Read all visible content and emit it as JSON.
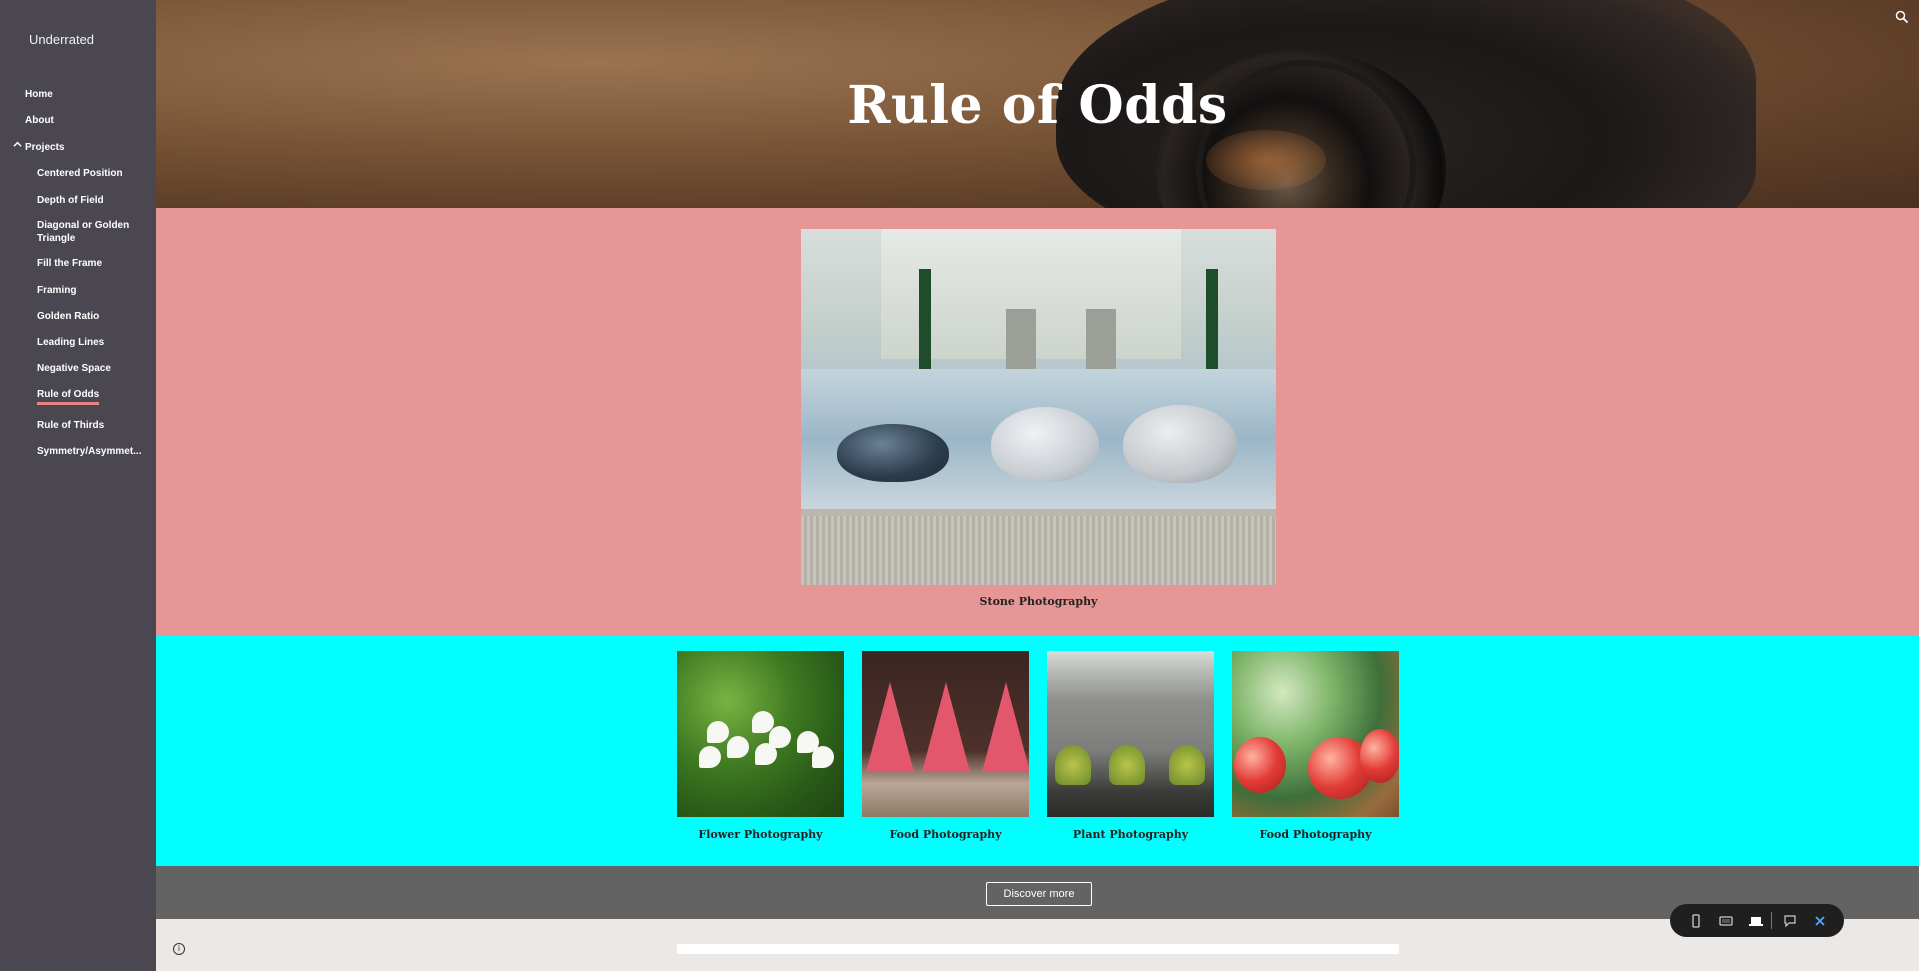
{
  "sidebar": {
    "site_title": "Underrated",
    "nav": {
      "home": "Home",
      "about": "About",
      "projects": "Projects",
      "sub": [
        "Centered Position",
        "Depth of Field",
        "Diagonal or Golden Triangle",
        "Fill the Frame",
        "Framing",
        "Golden Ratio",
        "Leading Lines",
        "Negative Space",
        "Rule of Odds",
        "Rule of Thirds",
        "Symmetry/Asymmet..."
      ],
      "active": "Rule of Odds"
    }
  },
  "header": {
    "title": "Rule of Odds"
  },
  "featured": {
    "caption": "Stone Photography"
  },
  "gallery": [
    {
      "caption": "Flower Photography"
    },
    {
      "caption": "Food Photography"
    },
    {
      "caption": "Plant Photography"
    },
    {
      "caption": "Food Photography"
    }
  ],
  "cta": {
    "discover_label": "Discover more"
  },
  "colors": {
    "sidebar_bg": "#4b4750",
    "active_underline": "#e58385",
    "pink_section": "#e79696",
    "cyan_section": "#00ffff",
    "gray_bar": "#636363",
    "footer_bg": "#ebe8e6",
    "toolbar_close": "#4fa8ff"
  },
  "icons": [
    "search-icon",
    "chevron-up-icon",
    "info-icon",
    "phone-view-icon",
    "tablet-view-icon",
    "laptop-view-icon",
    "feedback-icon",
    "close-icon"
  ]
}
